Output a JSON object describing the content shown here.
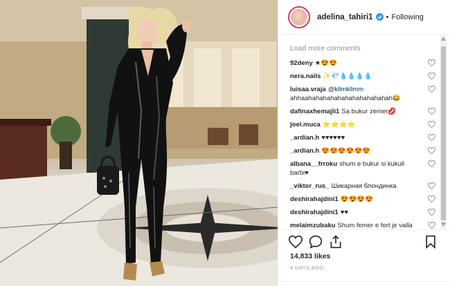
{
  "post": {
    "username": "adelina_tahiri1",
    "separator": "•",
    "follow_label": "Following",
    "likes": "14,833 likes",
    "timestamp": "4 DAYS AGO"
  },
  "comments_section": {
    "load_more": "Load more comments",
    "items": [
      {
        "user": "92deny",
        "text": "★😍😍"
      },
      {
        "user": "nera.nails",
        "text": "✨💎💧💧💧💧"
      },
      {
        "user": "luisaa.vraja",
        "mention": "@kllmkllmm",
        "text": "ahhaahahahahahahahahahahahah😂"
      },
      {
        "user": "dafinaxhemajli1",
        "text": "Sa bukur zemer💋"
      },
      {
        "user": "joel.muca",
        "text": "⭐⭐⭐⭐"
      },
      {
        "user": "_ardian.h",
        "text": "♥♥♥♥♥♥"
      },
      {
        "user": "_ardian.h",
        "text": "😍😍😍😍😍😍"
      },
      {
        "user": "albana__frroku",
        "text": "shum e bukur si kukull barbi♥"
      },
      {
        "user": "_viktor_rus_",
        "text": "Шикарная блондинка"
      },
      {
        "user": "deshirahajdini1",
        "text": "😍😍😍😍"
      },
      {
        "user": "deshirahajdini1",
        "text": "♥♥"
      },
      {
        "user": "melaimzubaku",
        "text": "Shum femer e fort je valla"
      }
    ]
  },
  "icons": {
    "verified": "verified-badge-icon",
    "like": "heart-icon",
    "comment": "comment-bubble-icon",
    "share": "share-icon",
    "save": "bookmark-icon"
  },
  "colors": {
    "accent": "#3897f0",
    "avatar_ring": "#e1306c",
    "muted": "#8e8e8e",
    "text": "#262626"
  }
}
